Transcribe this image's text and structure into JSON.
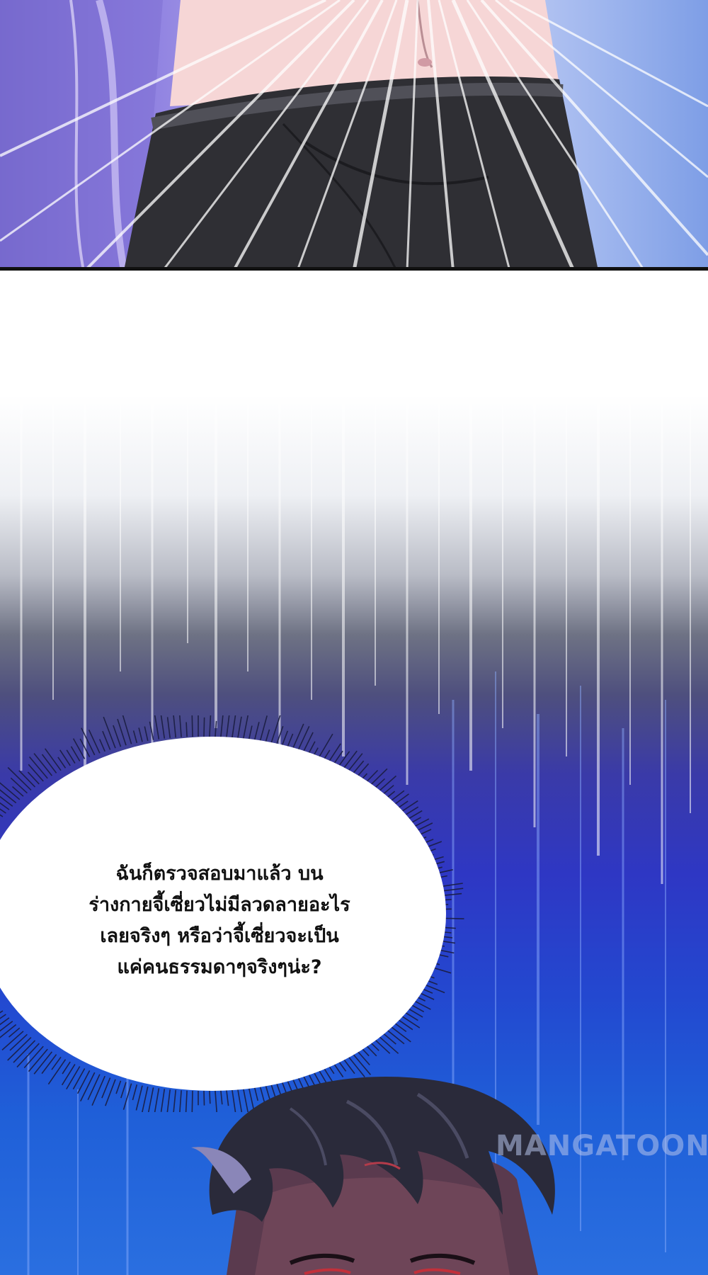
{
  "speech_bubble": {
    "lines": [
      "ฉันก็ตรวจสอบมาแล้ว บน",
      "ร่างกายจี้เซี่ยวไม่มีลวดลายอะไร",
      "เลยจริงๆ หรือว่าจี้เซี่ยวจะเป็น",
      "แค่คนธรรมดาๆจริงๆน่ะ?"
    ]
  },
  "watermark": "MANGATOON",
  "colors": {
    "top_panel_left": "#6f63c7",
    "top_panel_right": "#7e9ee6",
    "skin": "#f6d6d6",
    "pants": "#2f2f34",
    "speed_dark_blue": "#2e37c4",
    "speed_bright_blue": "#1f5fd8",
    "bubble_fill": "#ffffff",
    "text": "#111111",
    "hair": "#2a2a3a"
  },
  "icons": {
    "logo": "mangatoon-logo"
  }
}
